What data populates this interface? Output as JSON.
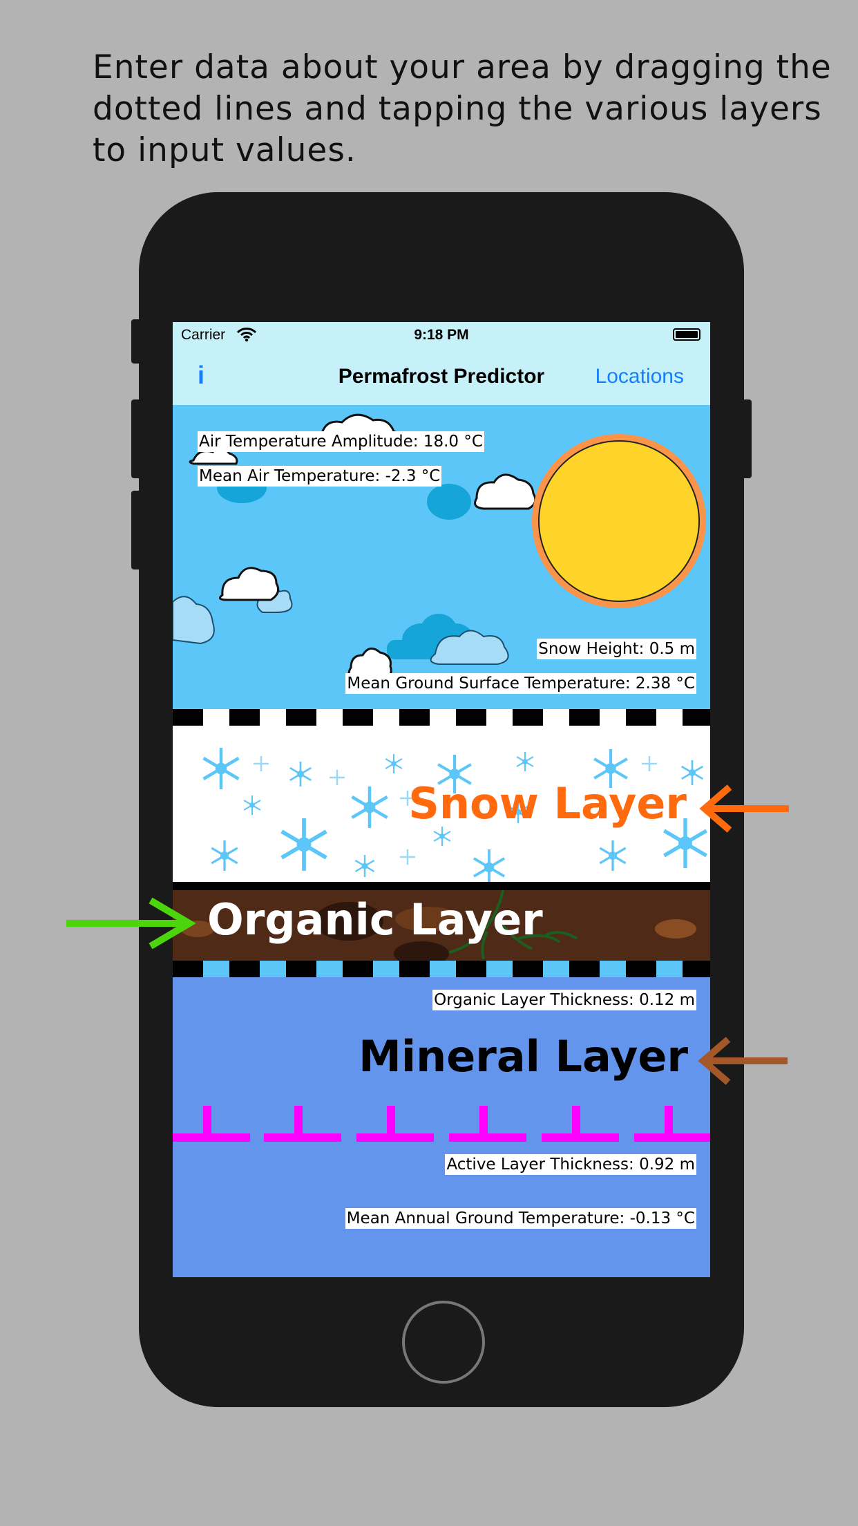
{
  "caption": "Enter data about your area by dragging the dotted lines and tapping the various layers to input values.",
  "status_bar": {
    "carrier": "Carrier",
    "time": "9:18 PM"
  },
  "nav": {
    "info_label": "i",
    "title": "Permafrost Predictor",
    "locations_label": "Locations"
  },
  "sky": {
    "air_temp_amplitude": "Air Temperature Amplitude: 18.0 °C",
    "mean_air_temp": "Mean Air Temperature: -2.3 °C",
    "snow_height": "Snow Height: 0.5 m",
    "mean_ground_surface_temp": "Mean Ground Surface Temperature: 2.38 °C"
  },
  "layers": {
    "snow": "Snow Layer",
    "organic": "Organic Layer",
    "mineral": "Mineral Layer"
  },
  "mineral": {
    "organic_thickness": "Organic Layer Thickness: 0.12 m",
    "active_thickness": "Active Layer Thickness: 0.92 m",
    "mean_annual_ground_temp": "Mean Annual Ground Temperature: -0.13 °C"
  },
  "colors": {
    "snow_arrow": "#ff6a0e",
    "organic_arrow": "#4cd40c",
    "mineral_arrow": "#a4582a",
    "permafrost_marker": "#ff00ff",
    "sky": "#5cc6f8",
    "mineral": "#6495ed",
    "organic": "#4e2a17",
    "sun": "#ffd42a",
    "sun_ring": "#f9944a"
  },
  "icons": [
    "wifi-icon",
    "battery-icon",
    "info-icon",
    "sun-icon",
    "cloud-icon",
    "snowflake-icon",
    "arrow-left-icon",
    "arrow-right-icon",
    "roots-icon"
  ]
}
